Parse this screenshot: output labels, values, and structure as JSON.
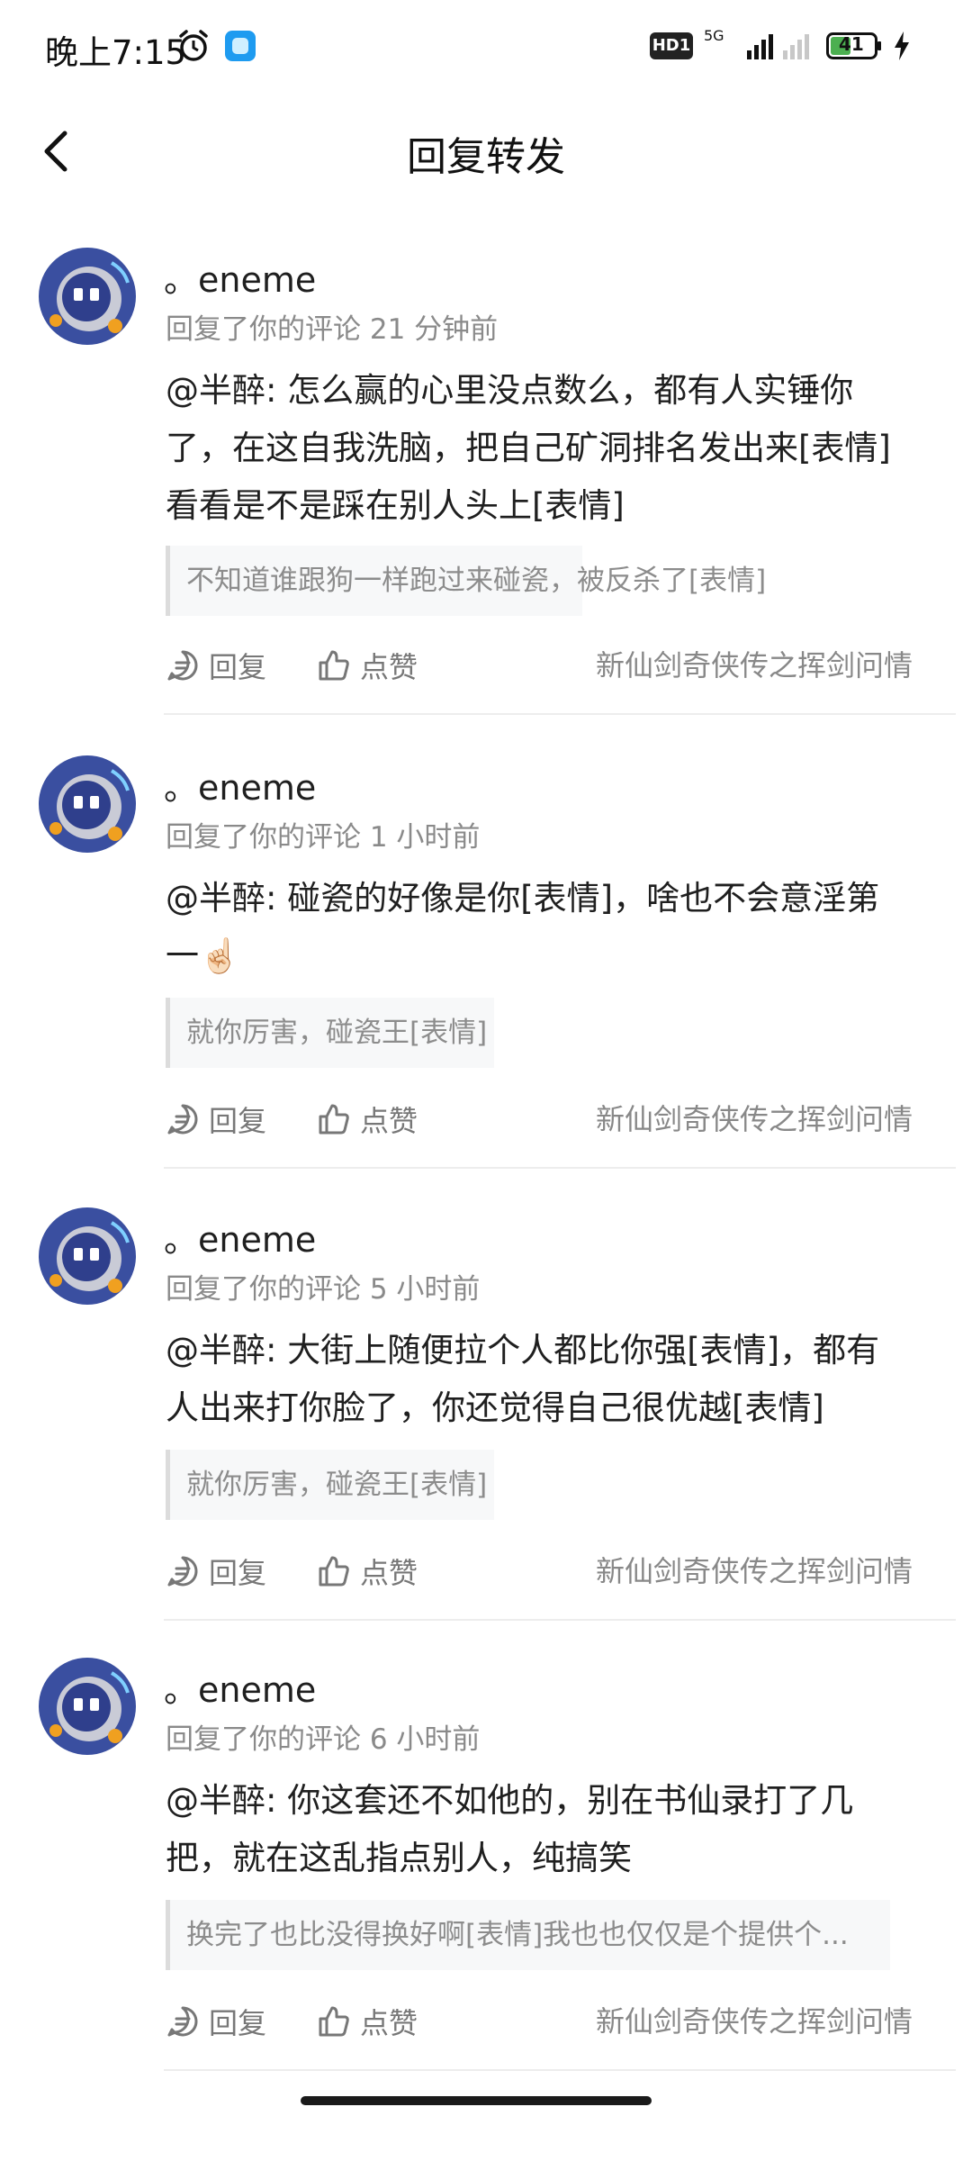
{
  "status_bar": {
    "time": "晚上7:15",
    "hd_label": "HD1",
    "network": "5G",
    "battery": "41",
    "icons": [
      "alarm-icon",
      "app-notification-icon",
      "signal-icon",
      "battery-icon",
      "charging-icon"
    ]
  },
  "header": {
    "title": "回复转发",
    "back_icon": "back-chevron-icon"
  },
  "labels": {
    "reply": "回复",
    "like": "点赞"
  },
  "colors": {
    "avatar_bg": "#3a4fa0",
    "avatar_ring": "#c9cbd6",
    "accent_orange": "#f0a020"
  },
  "comments": [
    {
      "username": "。eneme",
      "meta": "回复了你的评论 21 分钟前",
      "text": "@半醉: 怎么赢的心里没点数么，都有人实锤你了，在这自我洗脑，把自己矿洞排名发出来[表情]看看是不是踩在别人头上[表情]",
      "quote": "不知道谁跟狗一样跑过来碰瓷，被反杀了[表情]",
      "game": "新仙剑奇侠传之挥剑问情"
    },
    {
      "username": "。eneme",
      "meta": "回复了你的评论 1 小时前",
      "text": "@半醉: 碰瓷的好像是你[表情]，啥也不会意淫第一☝🏻",
      "quote": "就你厉害，碰瓷王[表情]",
      "game": "新仙剑奇侠传之挥剑问情"
    },
    {
      "username": "。eneme",
      "meta": "回复了你的评论 5 小时前",
      "text": "@半醉: 大街上随便拉个人都比你强[表情]，都有人出来打你脸了，你还觉得自己很优越[表情]",
      "quote": "就你厉害，碰瓷王[表情]",
      "game": "新仙剑奇侠传之挥剑问情"
    },
    {
      "username": "。eneme",
      "meta": "回复了你的评论 6 小时前",
      "text": "@半醉: 你这套还不如他的，别在书仙录打了几把，就在这乱指点别人，纯搞笑",
      "quote": "换完了也比没得换好啊[表情]我也也仅仅是个提供个...",
      "game": "新仙剑奇侠传之挥剑问情"
    }
  ]
}
